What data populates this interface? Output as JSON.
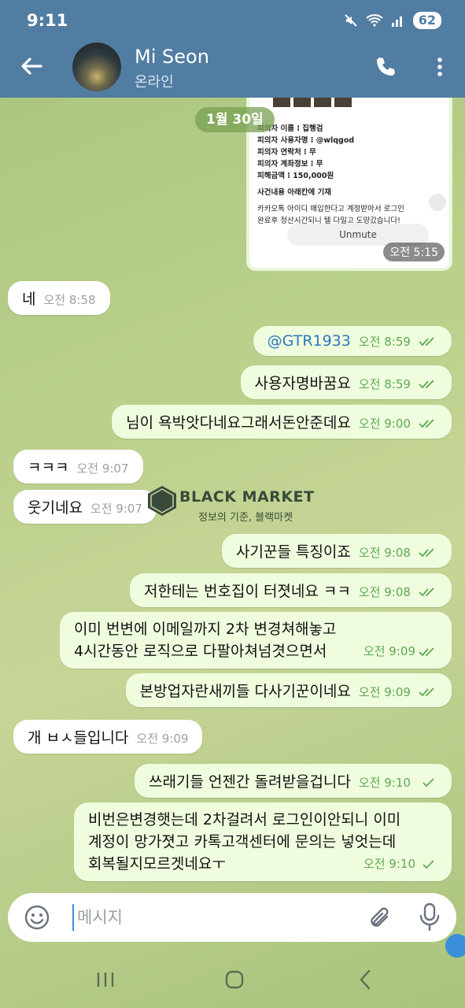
{
  "status_bar": {
    "time": "9:11",
    "battery": "62",
    "network": "Wi-Fi"
  },
  "header": {
    "name": "Mi Seon",
    "status": "온라인"
  },
  "media": {
    "lines": [
      "피의자 이름 ⁝ 집행검",
      "피의자 사용자명 ⁝ @wlqgod",
      "피의자 연락처 ⁝ 무",
      "피의자 계좌정보 ⁝ 무",
      "피해금액 ⁝ 150,000원",
      "사건내용 아래칸에 기재",
      "카카오톡 아이디 매입한다고 계정받아서 로그인",
      "완료후 정산시간되니 텔 다밀고 도망갔습니다!"
    ],
    "unmute": "Unmute",
    "time": "오전 5:15"
  },
  "date_chip": "1월 30일",
  "messages": [
    {
      "dir": "in",
      "text": "네",
      "time": "오전 8:58"
    },
    {
      "dir": "out",
      "text": "@GTR1933",
      "time": "오전 8:59"
    },
    {
      "dir": "out",
      "text": "사용자명바꿈요",
      "time": "오전 8:59"
    },
    {
      "dir": "out",
      "text": "님이 욕박앗다네요그래서돈안준데요",
      "time": "오전 9:00"
    },
    {
      "dir": "in",
      "text": "ㅋㅋㅋ",
      "time": "오전 9:07"
    },
    {
      "dir": "in",
      "text": "웃기네요",
      "time": "오전 9:07"
    },
    {
      "dir": "out",
      "text": "사기꾼들 특징이죠",
      "time": "오전 9:08"
    },
    {
      "dir": "out",
      "text": "저한테는 번호집이 터졋네요 ㅋㅋ",
      "time": "오전 9:08"
    },
    {
      "dir": "out",
      "text": "이미 번변에 이메일까지 2차 변경쳐해놓고\n4시간동안  로직으로 다팔아쳐넘겻으면서",
      "time": "오전 9:09"
    },
    {
      "dir": "out",
      "text": "본방업자란새끼들 다사기꾼이네요",
      "time": "오전 9:09"
    },
    {
      "dir": "in",
      "text": "개 ㅂㅅ들입니다",
      "time": "오전 9:09"
    },
    {
      "dir": "out",
      "text": "쓰래기들 언젠간 돌려받을겁니다",
      "time": "오전 9:10"
    },
    {
      "dir": "out",
      "text": "비번은변경햇는데 2차걸려서 로그인이안되니 이미\n계정이 망가졋고 카톡고객센터에 문의는 넣엇는데\n회복될지모르겟네요ㅜ",
      "time": "오전 9:10"
    }
  ],
  "watermark": {
    "title": "BLACK MARKET",
    "subtitle": "정보의 기준, 블랙마켓"
  },
  "input": {
    "placeholder": "메시지",
    "value": ""
  },
  "icons": [
    "back-arrow-icon",
    "phone-icon",
    "more-vert-icon",
    "emoji-icon",
    "paperclip-icon",
    "microphone-icon",
    "read-check-icon",
    "sent-check-icon"
  ],
  "colors": {
    "header": "#517da2",
    "bubble_out": "#effdde",
    "bubble_in": "#ffffff",
    "check": "#5ea954",
    "link": "#2a78c2"
  }
}
